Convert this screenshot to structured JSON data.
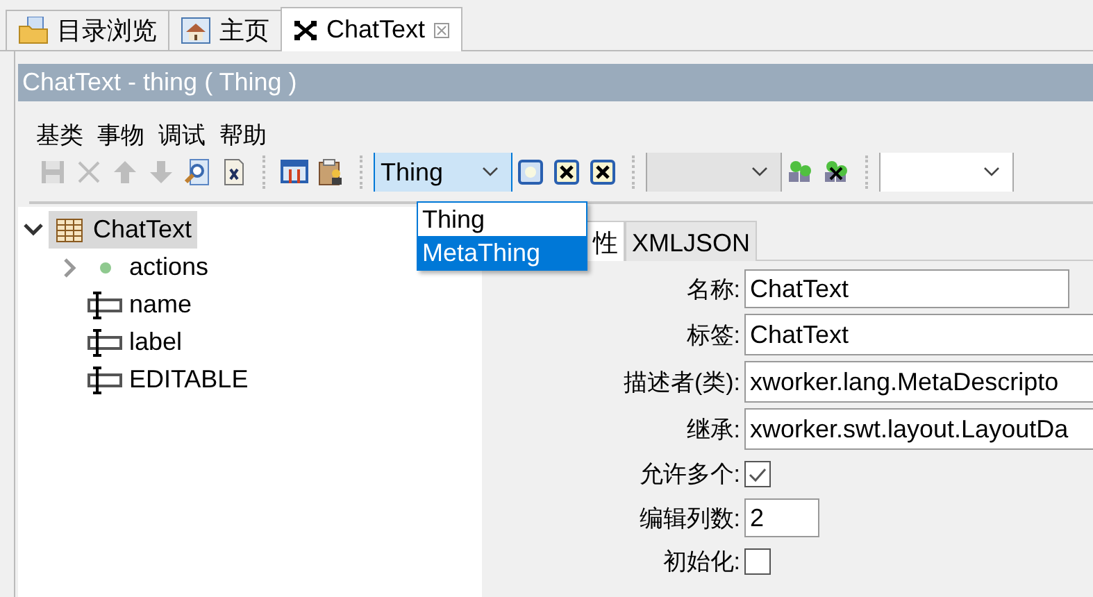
{
  "tabs": [
    {
      "label": "目录浏览",
      "kind": "folder",
      "selected": false
    },
    {
      "label": "主页",
      "kind": "home",
      "selected": false
    },
    {
      "label": "ChatText",
      "kind": "thing",
      "selected": true
    }
  ],
  "editor": {
    "title": "ChatText - thing ( Thing )"
  },
  "menu": [
    "基类",
    "事物",
    "调试",
    "帮助"
  ],
  "toolbar": {
    "buttons": [
      {
        "disabled": true
      },
      {
        "disabled": true
      },
      {
        "disabled": true
      },
      {
        "disabled": true
      },
      {
        "disabled": false
      },
      {
        "disabled": false
      },
      {
        "disabled": false
      },
      {
        "disabled": false
      }
    ],
    "combos": [
      {
        "value": "Thing",
        "expanded": true,
        "disabled": false
      },
      {
        "disabled": true,
        "expanded": false
      },
      {
        "disabled": false,
        "expanded": false
      }
    ],
    "dropdown": [
      {
        "label": "Thing",
        "selected": false
      },
      {
        "label": "MetaThing",
        "selected": true
      }
    ]
  },
  "tree": [
    {
      "label": "ChatText",
      "kind": "table",
      "selected": true,
      "expanded": true,
      "children": [
        {
          "label": "actions",
          "kind": "dot",
          "selected": false,
          "expanded": false
        },
        {
          "label": "name",
          "kind": "attribute",
          "selected": false
        },
        {
          "label": "label",
          "kind": "attribute",
          "selected": false
        },
        {
          "label": "EDITABLE",
          "kind": "attribute",
          "selected": false
        }
      ]
    }
  ],
  "prop_tabs": [
    {
      "label": "性",
      "selected": true
    },
    {
      "label": "XMLJSON",
      "selected": false
    }
  ],
  "properties": [
    {
      "label": "名称:",
      "kind": "text",
      "value": "ChatText"
    },
    {
      "label": "标签:",
      "kind": "long_text",
      "value": "ChatText"
    },
    {
      "label": "描述者(类):",
      "kind": "long_text",
      "value": "xworker.lang.MetaDescripto"
    },
    {
      "label": "继承:",
      "kind": "long_text",
      "value": "xworker.swt.layout.LayoutDa"
    },
    {
      "label": "允许多个:",
      "kind": "checkbox",
      "checked": true
    },
    {
      "label": "编辑列数:",
      "kind": "number",
      "value": "2"
    },
    {
      "label": "初始化:",
      "kind": "checkbox",
      "checked": false
    }
  ]
}
